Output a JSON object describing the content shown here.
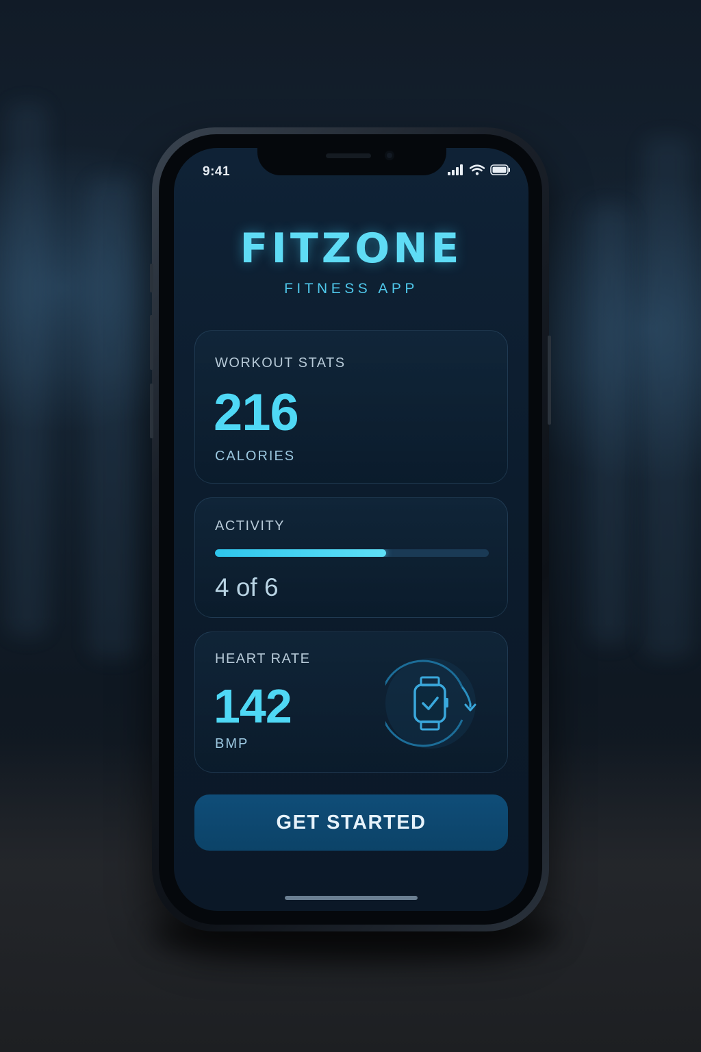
{
  "status_bar": {
    "time": "9:41",
    "icons": [
      "signal-icon",
      "wifi-icon",
      "battery-icon"
    ]
  },
  "brand": {
    "name": "FITZONE",
    "subtitle": "FITNESS APP"
  },
  "workout_stats": {
    "label": "WORKOUT STATS",
    "value": "216",
    "unit": "CALORIES"
  },
  "activity": {
    "label": "ACTIVITY",
    "progress_text": "4 of 6",
    "progress_fraction": 0.625
  },
  "heart_rate": {
    "label": "HEART RATE",
    "value": "142",
    "unit": "BMP",
    "icon": "smartwatch-sync-icon"
  },
  "cta": {
    "label": "GET STARTED"
  },
  "colors": {
    "accent": "#4fd8f5",
    "button": "#0f4d78",
    "background": "#0c1c2d"
  }
}
